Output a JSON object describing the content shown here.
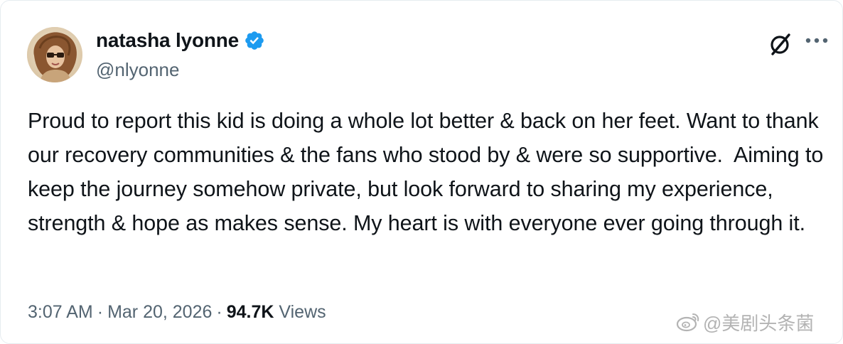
{
  "user": {
    "display_name": "natasha lyonne",
    "handle": "@nlyonne",
    "verified": true
  },
  "tweet": {
    "text": "Proud to report this kid is doing a whole lot better & back on her feet. Want to thank our recovery communities & the fans who stood by & were so supportive.  Aiming to keep the journey somehow private, but look forward to sharing my experience, strength & hope as makes sense. My heart is with everyone ever going through it.",
    "time": "3:07 AM",
    "separator": "·",
    "date": "Mar 20, 2026",
    "views_count": "94.7K",
    "views_label": "Views"
  },
  "actions": {
    "grok_icon": "grok-icon",
    "more_icon": "more-icon"
  },
  "watermark": {
    "text": "@美剧头条菌",
    "icon": "weibo-logo"
  },
  "colors": {
    "verified_blue": "#1d9bf0",
    "secondary_text": "#536471",
    "primary_text": "#0f1419"
  }
}
